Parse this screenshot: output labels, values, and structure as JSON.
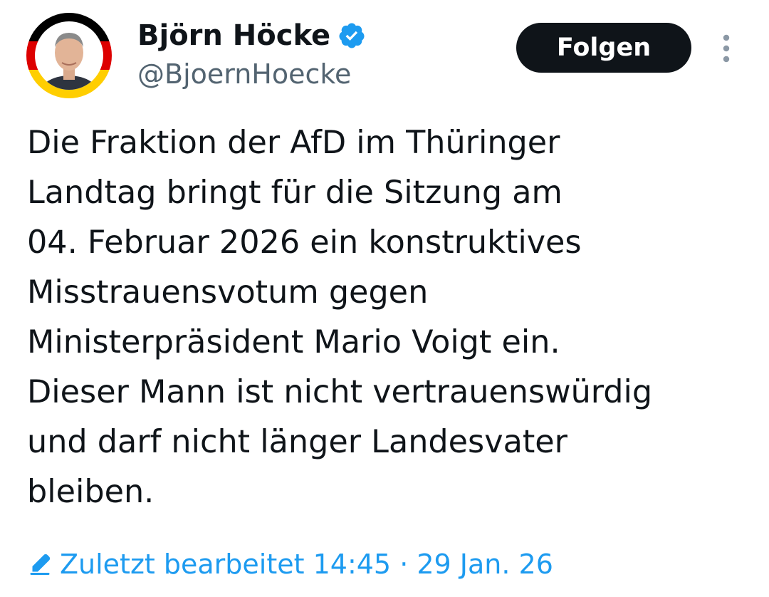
{
  "author": {
    "display_name": "Björn Höcke",
    "handle": "@BjoernHoecke",
    "verified_icon": "verified-badge-icon",
    "avatar_ring_colors": [
      "#000000",
      "#dd0000",
      "#ffce00"
    ]
  },
  "actions": {
    "follow_label": "Folgen",
    "more_icon": "more-vertical-icon"
  },
  "tweet": {
    "text": "Die Fraktion der AfD im Thüringer\nLandtag bringt für die Sitzung am\n04. Februar 2026 ein konstruktives\nMisstrauensvotum gegen\nMinisterpräsident Mario Voigt ein.\nDieser Mann ist nicht vertrauenswürdig\nund darf nicht länger Landesvater\nbleiben."
  },
  "edit_info": {
    "icon": "pencil-icon",
    "label": "Zuletzt bearbeitet 14:45 · 29 Jan. 26"
  },
  "colors": {
    "accent": "#1d9bf0",
    "text_primary": "#0f1419",
    "text_secondary": "#536471",
    "button_bg": "#0f1419",
    "button_text": "#ffffff"
  }
}
